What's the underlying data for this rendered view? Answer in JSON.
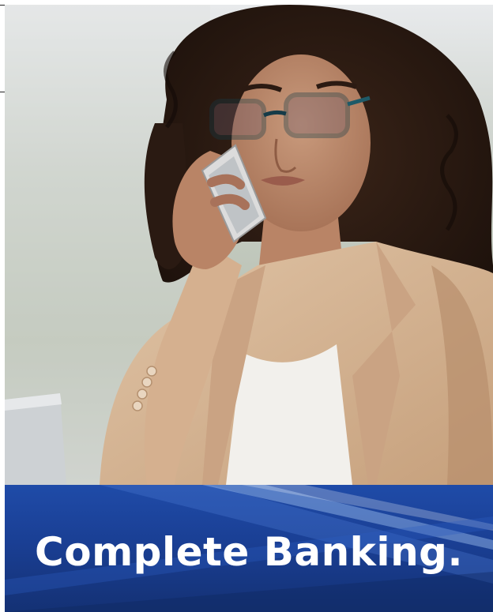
{
  "photo": {
    "icon": "woman-on-phone-photo"
  },
  "banner": {
    "headline": "Complete Banking."
  },
  "colors": {
    "banner_top": "#1f4ba8",
    "banner_bottom": "#143174",
    "headline": "#ffffff",
    "blazer": "#d7b594",
    "hair": "#2a1a12"
  }
}
